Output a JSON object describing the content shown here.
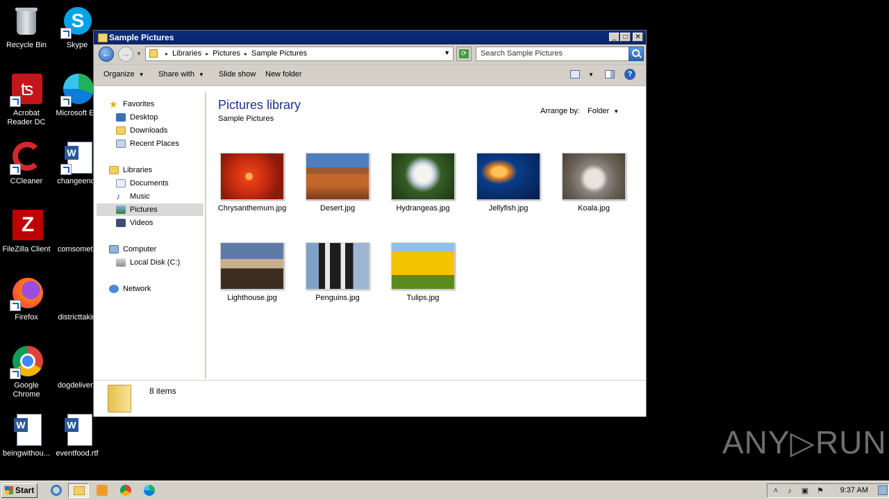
{
  "desktop": {
    "icons": [
      {
        "label": "Recycle Bin"
      },
      {
        "label": "Skype"
      },
      {
        "label": "Acrobat Reader DC"
      },
      {
        "label": "Microsoft Ed"
      },
      {
        "label": "CCleaner"
      },
      {
        "label": "changeend."
      },
      {
        "label": "FileZilla Client"
      },
      {
        "label": "comsometi."
      },
      {
        "label": "Firefox"
      },
      {
        "label": "districttakin"
      },
      {
        "label": "Google Chrome"
      },
      {
        "label": "dogdelivery"
      },
      {
        "label": "beingwithou..."
      },
      {
        "label": "eventfood.rtf"
      }
    ]
  },
  "window": {
    "title": "Sample Pictures",
    "address": {
      "crumbs": [
        "Libraries",
        "Pictures",
        "Sample Pictures"
      ]
    },
    "search_placeholder": "Search Sample Pictures",
    "toolbar": {
      "organize": "Organize",
      "share_with": "Share with",
      "slide_show": "Slide show",
      "new_folder": "New folder"
    },
    "nav": {
      "favorites": "Favorites",
      "desktop": "Desktop",
      "downloads": "Downloads",
      "recent_places": "Recent Places",
      "libraries": "Libraries",
      "documents": "Documents",
      "music": "Music",
      "pictures": "Pictures",
      "videos": "Videos",
      "computer": "Computer",
      "local_disk": "Local Disk (C:)",
      "network": "Network"
    },
    "content": {
      "title": "Pictures library",
      "subtitle": "Sample Pictures",
      "arrange_by_label": "Arrange by:",
      "arrange_by_value": "Folder",
      "files": [
        {
          "name": "Chrysanthemum.jpg"
        },
        {
          "name": "Desert.jpg"
        },
        {
          "name": "Hydrangeas.jpg"
        },
        {
          "name": "Jellyfish.jpg"
        },
        {
          "name": "Koala.jpg"
        },
        {
          "name": "Lighthouse.jpg"
        },
        {
          "name": "Penguins.jpg"
        },
        {
          "name": "Tulips.jpg"
        }
      ]
    },
    "status": "8 items"
  },
  "taskbar": {
    "start_label": "Start",
    "clock": "9:37 AM"
  },
  "watermark": "ANY▷RUN"
}
